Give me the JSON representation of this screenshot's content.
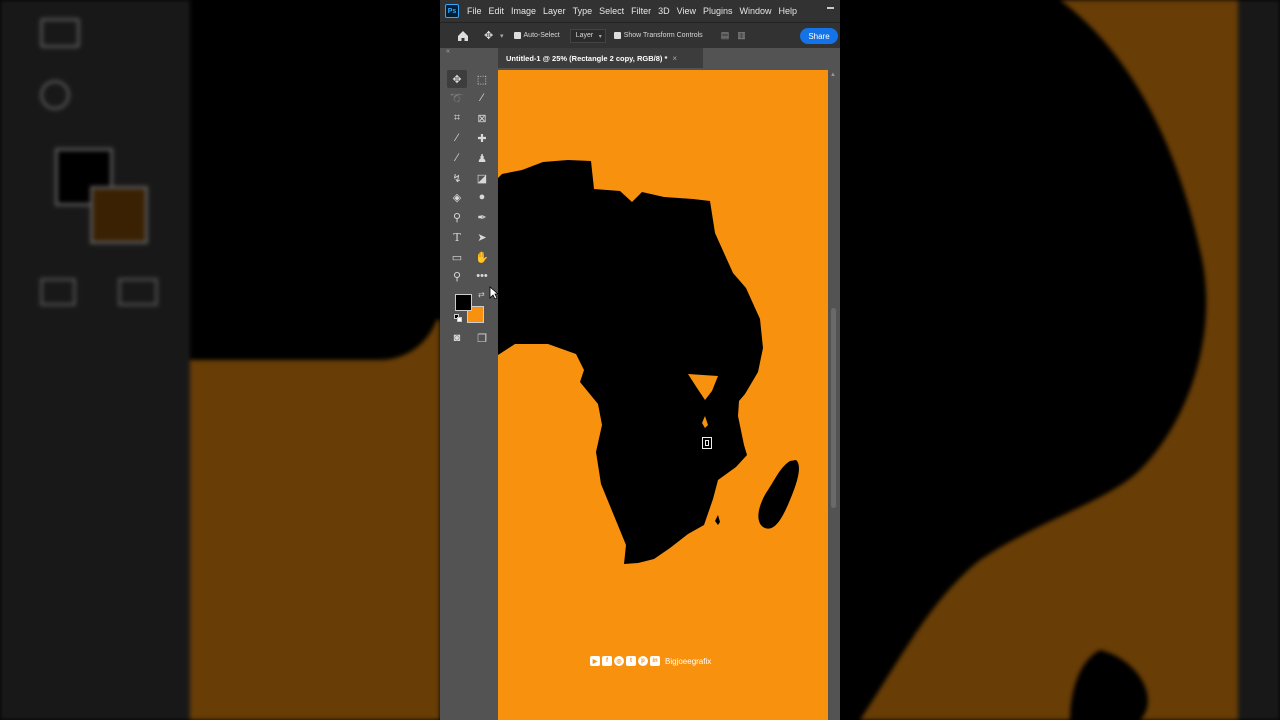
{
  "app": {
    "logo_text": "Ps",
    "menu": [
      "File",
      "Edit",
      "Image",
      "Layer",
      "Type",
      "Select",
      "Filter",
      "3D",
      "View",
      "Plugins",
      "Window",
      "Help"
    ]
  },
  "options_bar": {
    "auto_select_label": "Auto-Select",
    "auto_select_checked": true,
    "layer_select_value": "Layer",
    "show_transform_label": "Show Transform Controls",
    "show_transform_checked": true,
    "share_label": "Share"
  },
  "document": {
    "tab_title": "Untitled-1 @ 25% (Rectangle 2 copy, RGB/8) *",
    "close_glyph": "×"
  },
  "colors": {
    "foreground": "#000000",
    "background": "#f7910e",
    "ui_dark": "#323232",
    "ui_panel": "#535353",
    "accent": "#1473e6"
  },
  "toolbar": {
    "tools": [
      "move-tool",
      "marquee-tool",
      "lasso-tool",
      "magic-wand-tool",
      "crop-tool",
      "frame-tool",
      "eyedropper-tool",
      "healing-brush-tool",
      "brush-tool",
      "clone-stamp-tool",
      "history-brush-tool",
      "eraser-tool",
      "paint-bucket-tool",
      "blur-tool",
      "dodge-tool",
      "pen-tool",
      "type-tool",
      "path-selection-tool",
      "rectangle-tool",
      "hand-tool",
      "zoom-tool",
      "more-tools",
      "quick-mask-mode",
      "screen-mode"
    ],
    "active_tool": "move-tool"
  },
  "watermark": {
    "icons": [
      "youtube-icon",
      "facebook-icon",
      "instagram-icon",
      "twitter-icon",
      "pinterest-icon",
      "linkedin-icon"
    ],
    "text": "Bigjoeegrafix"
  }
}
